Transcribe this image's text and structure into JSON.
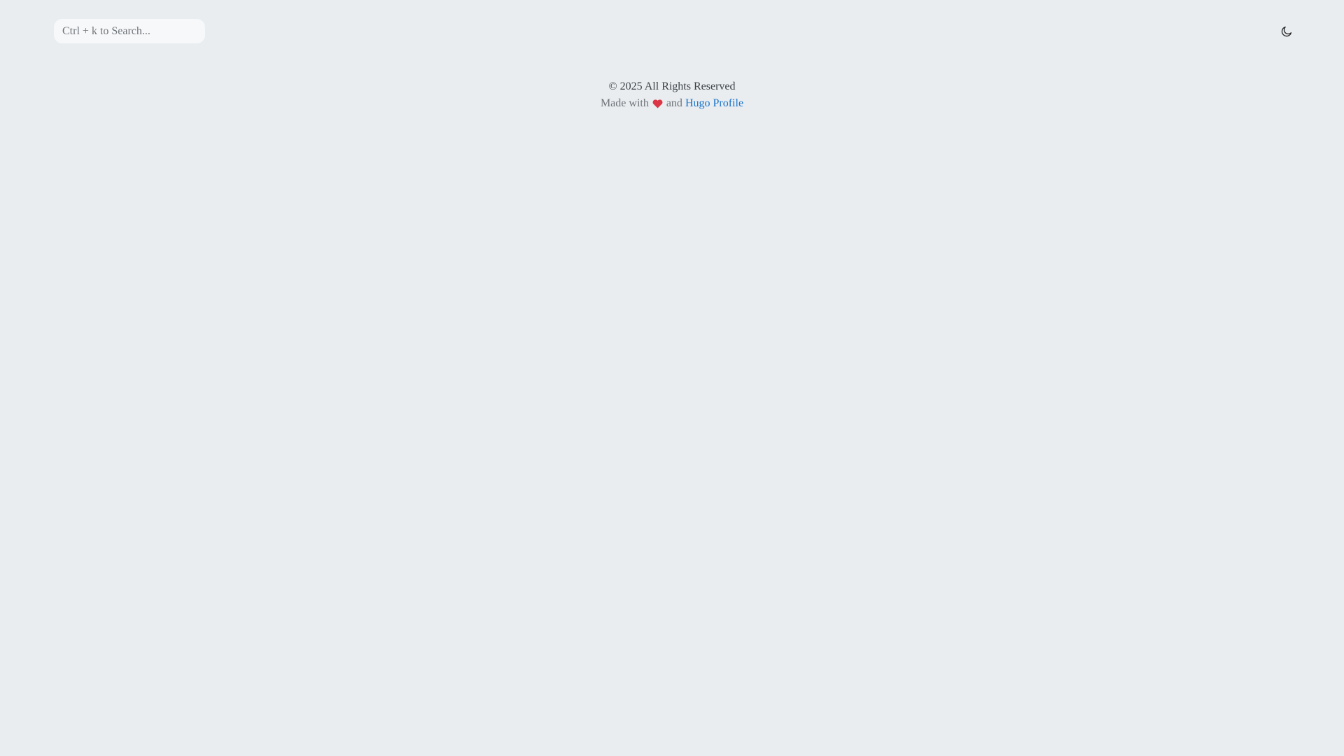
{
  "header": {
    "search": {
      "placeholder": "Ctrl + k to Search...",
      "value": ""
    },
    "theme_toggle_icon": "moon-icon"
  },
  "footer": {
    "copyright": "© 2025 All Rights Reserved",
    "made_with_prefix": "Made with",
    "heart_icon": "heart-icon",
    "and_text": "and",
    "link_text": "Hugo Profile"
  },
  "colors": {
    "background": "#e9edf0",
    "heart": "#dc3545",
    "link": "#1a73c8"
  }
}
